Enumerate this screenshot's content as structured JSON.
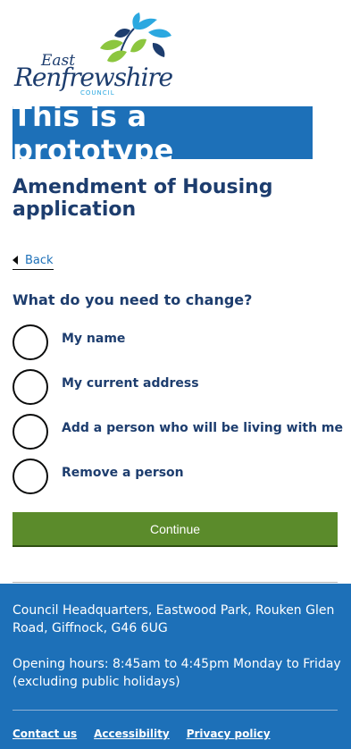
{
  "logo": {
    "line1": "East",
    "line2": "Renfrewshire",
    "line3": "COUNCIL",
    "colors": {
      "navy": "#1d3d6e",
      "blue": "#2ba8e0",
      "green": "#8cc63f"
    }
  },
  "banner": {
    "text": "This is a prototype",
    "color": "#1d70b8"
  },
  "page": {
    "title": "Amendment of Housing application"
  },
  "back": {
    "label": "Back"
  },
  "form": {
    "question": "What do you need to change?",
    "options": [
      {
        "label": "My name",
        "selected": false
      },
      {
        "label": "My current address",
        "selected": false
      },
      {
        "label": "Add a person who will be living with me",
        "selected": false
      },
      {
        "label": "Remove a person",
        "selected": false
      }
    ],
    "continue_label": "Continue",
    "continue_color": "#5b8b2b"
  },
  "footer": {
    "address": "Council Headquarters, Eastwood Park, Rouken Glen Road, Giffnock, G46 6UG",
    "hours": "Opening hours: 8:45am to 4:45pm Monday to Friday (excluding public holidays)",
    "links": [
      "Contact us",
      "Accessibility",
      "Privacy policy"
    ],
    "background": "#1d70b8"
  }
}
